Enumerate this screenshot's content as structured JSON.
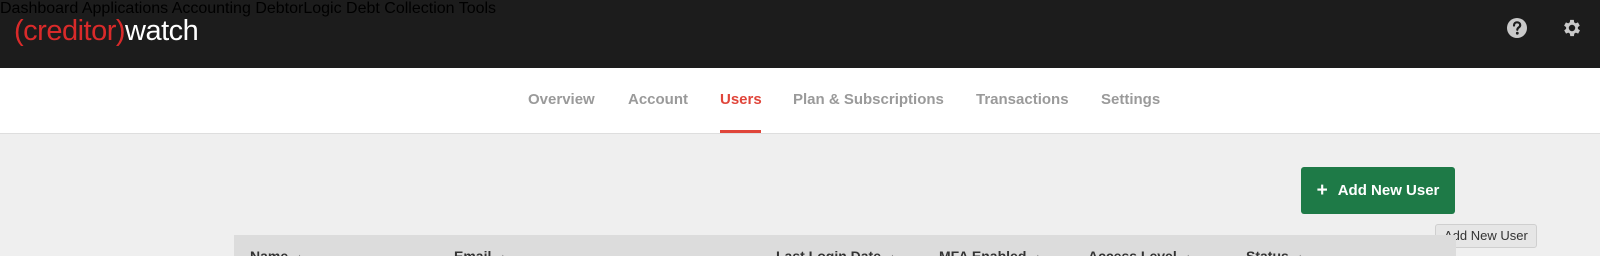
{
  "brand": {
    "logo_left": "(creditor)",
    "logo_right": "watch"
  },
  "main_nav": [
    {
      "label": "Dashboard"
    },
    {
      "label": "Applications"
    },
    {
      "label": "Accounting"
    },
    {
      "label": "DebtorLogic"
    },
    {
      "label": "Debt Collection Tools"
    }
  ],
  "top_icons": [
    "help-circle-icon",
    "gear-icon"
  ],
  "sub_nav": {
    "active": "Users",
    "items": [
      {
        "label": "Overview"
      },
      {
        "label": "Account"
      },
      {
        "label": "Users"
      },
      {
        "label": "Plan & Subscriptions"
      },
      {
        "label": "Transactions"
      },
      {
        "label": "Settings"
      }
    ]
  },
  "actions": {
    "add_user_label": "Add New User",
    "add_user_tooltip": "Add New User"
  },
  "table": {
    "columns": [
      "Name",
      "Email",
      "Last Login Date",
      "MFA Enabled",
      "Access Level",
      "Status"
    ]
  },
  "colors": {
    "accent_red": "#e0453a",
    "primary_green": "#1e7a47",
    "topbar": "#1c1c1c"
  }
}
